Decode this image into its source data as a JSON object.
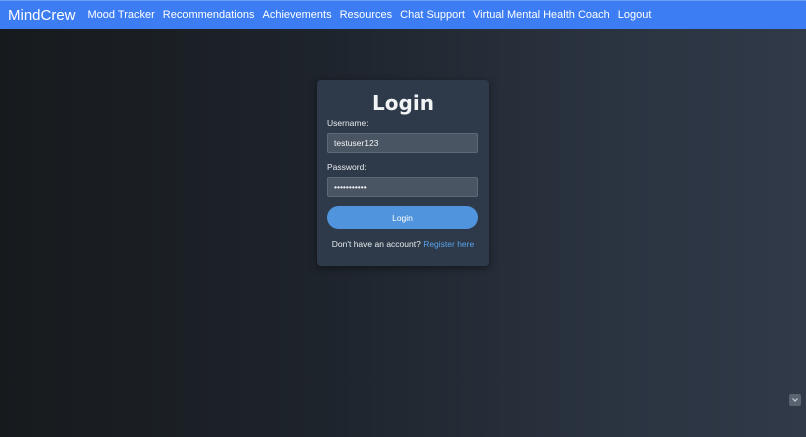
{
  "navbar": {
    "brand": "MindCrew",
    "links": [
      {
        "label": "Mood Tracker"
      },
      {
        "label": "Recommendations"
      },
      {
        "label": "Achievements"
      },
      {
        "label": "Resources"
      },
      {
        "label": "Chat Support"
      },
      {
        "label": "Virtual Mental Health Coach"
      },
      {
        "label": "Logout"
      }
    ]
  },
  "login": {
    "title": "Login",
    "username_label": "Username:",
    "username_value": "testuser123",
    "password_label": "Password:",
    "password_value": "password123",
    "submit_label": "Login",
    "register_prompt": "Don't have an account?",
    "register_link": "Register here"
  },
  "icons": {
    "corner_widget": "chevron-down-icon"
  },
  "colors": {
    "navbar": "#3d7df3",
    "card": "#2e3a4a",
    "button": "#4f94dc",
    "link": "#5aa2ea"
  }
}
